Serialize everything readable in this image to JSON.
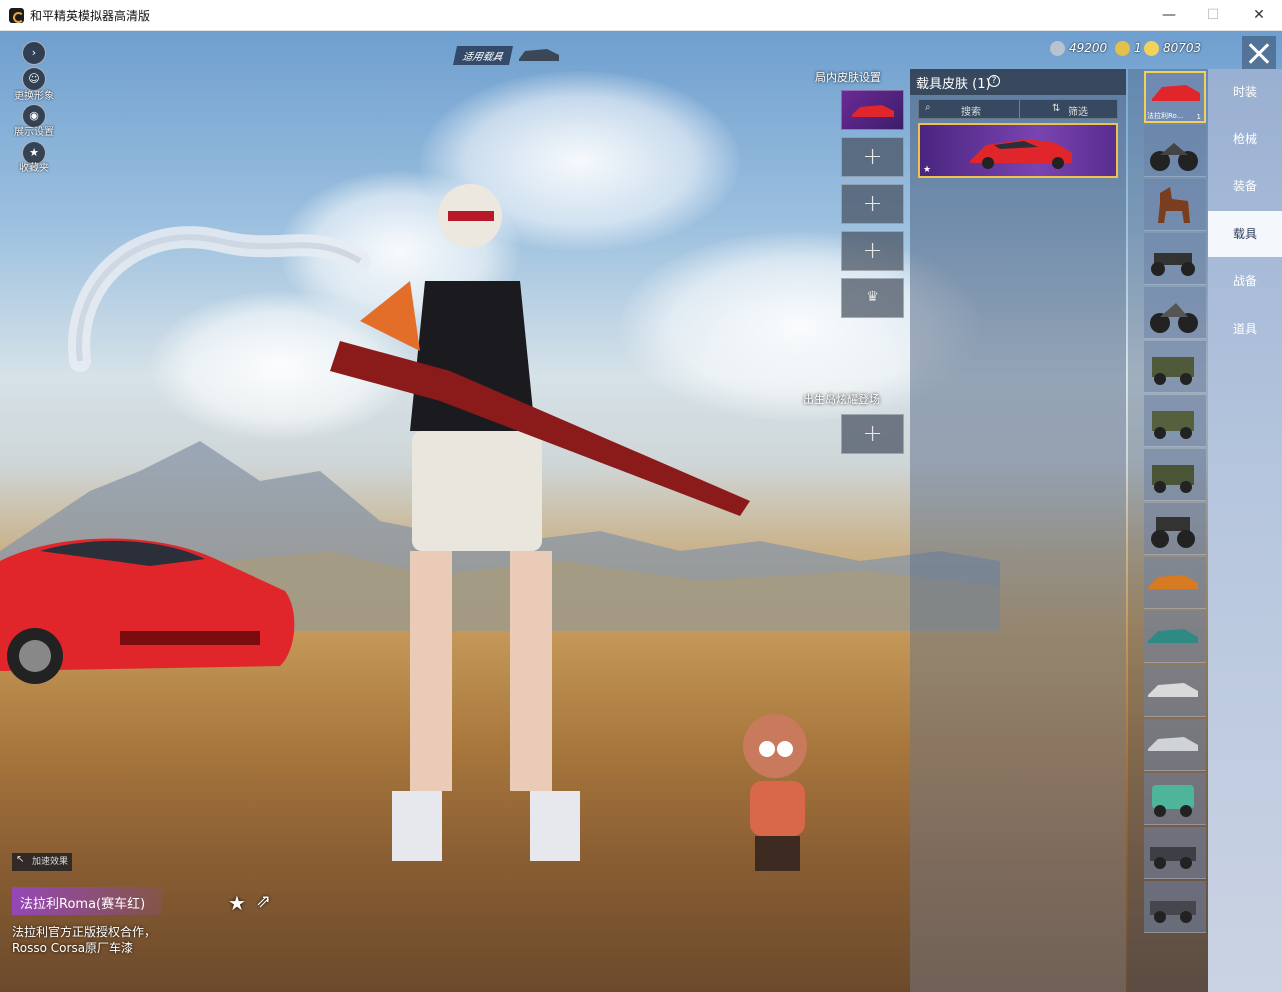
{
  "window": {
    "title": "和平精英模拟器高清版",
    "minimize": "—",
    "maximize": "☐",
    "close": "✕"
  },
  "left_menu": [
    {
      "label": ""
    },
    {
      "label": "更换形象"
    },
    {
      "label": "展示设置"
    },
    {
      "label": "收藏夹"
    }
  ],
  "vehicle_tag": "适用载具",
  "currency": [
    {
      "value": "49200",
      "color": "#b9c2cf"
    },
    {
      "value": "1",
      "color": "#e3c04a"
    },
    {
      "value": "80703",
      "color": "#f2d35a"
    }
  ],
  "slots": {
    "title": "局内皮肤设置",
    "emote_title": "出生岛炫耀登场",
    "plus": "+"
  },
  "panel": {
    "title": "载具皮肤 (1)",
    "help": "?",
    "search_placeholder": "搜索",
    "filter_label": "筛选"
  },
  "rail": {
    "selected_label": "法拉利Ro...",
    "selected_count": "1"
  },
  "tabs": [
    "时装",
    "枪械",
    "装备",
    "载具",
    "战备",
    "道具"
  ],
  "active_tab": "载具",
  "skin": {
    "effect_tag": "加速效果",
    "name": "法拉利Roma(赛车红)",
    "description": "法拉利官方正版授权合作，Rosso Corsa原厂车漆"
  },
  "colors": {
    "accent": "#f0c24a",
    "skin_purple": "#9646be",
    "ferrari_red": "#e0262b"
  }
}
